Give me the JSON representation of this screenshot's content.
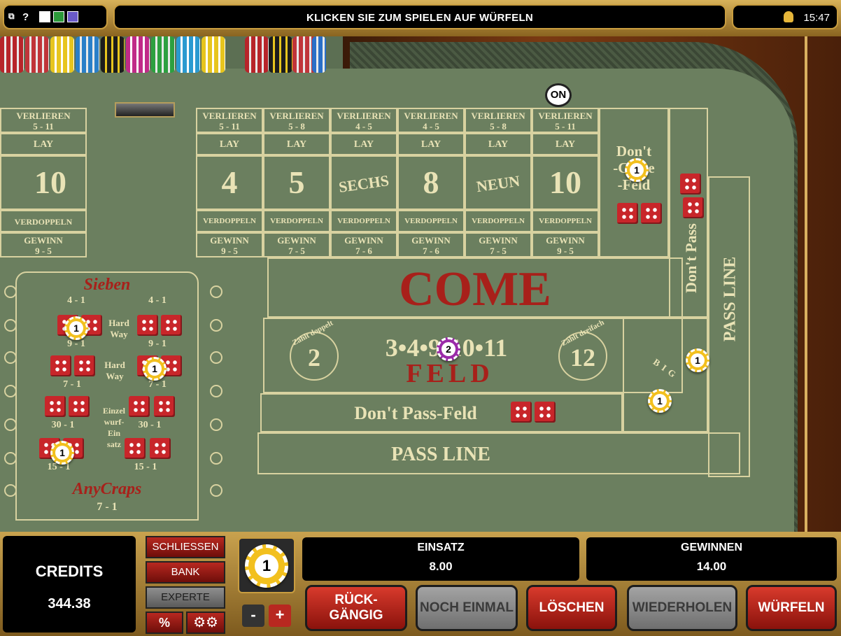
{
  "topbar": {
    "title": "KLICKEN SIE ZUM SPIELEN AUF WÜRFELN",
    "time": "15:47",
    "icons": [
      "window-icon",
      "help-icon",
      "checklist-icon",
      "dollar-icon",
      "stats-icon",
      "sound-icon"
    ]
  },
  "table": {
    "on_marker": "ON",
    "numbers": [
      {
        "top": "VERLIEREN",
        "top_odds": "5 - 11",
        "lay": "LAY",
        "number": "4",
        "double": "VERDOPPELN",
        "win": "GEWINN",
        "win_odds": "9 - 5"
      },
      {
        "top": "VERLIEREN",
        "top_odds": "5 - 8",
        "lay": "LAY",
        "number": "5",
        "double": "VERDOPPELN",
        "win": "GEWINN",
        "win_odds": "7 - 5"
      },
      {
        "top": "VERLIEREN",
        "top_odds": "4 - 5",
        "lay": "LAY",
        "number": "SECHS",
        "double": "VERDOPPELN",
        "win": "GEWINN",
        "win_odds": "7 - 6"
      },
      {
        "top": "VERLIEREN",
        "top_odds": "4 - 5",
        "lay": "LAY",
        "number": "8",
        "double": "VERDOPPELN",
        "win": "GEWINN",
        "win_odds": "7 - 6"
      },
      {
        "top": "VERLIEREN",
        "top_odds": "5 - 8",
        "lay": "LAY",
        "number": "NEUN",
        "double": "VERDOPPELN",
        "win": "GEWINN",
        "win_odds": "7 - 5"
      },
      {
        "top": "VERLIEREN",
        "top_odds": "5 - 11",
        "lay": "LAY",
        "number": "10",
        "double": "VERDOPPELN",
        "win": "GEWINN",
        "win_odds": "9 - 5"
      }
    ],
    "left_partial": {
      "top": "VERLIEREN",
      "top_odds": "5 - 11",
      "lay": "LAY",
      "number": "10",
      "double": "VERDOPPELN",
      "win": "GEWINN",
      "win_odds": "9 - 5"
    },
    "dont_come": "Don't Come -Feld",
    "dont_come_line1": "Don't",
    "dont_come_line2": "-Come",
    "dont_come_line3": "-Feld",
    "come": "COME",
    "field": {
      "label": "FELD",
      "double_note": "Zählt doppelt",
      "triple_note": "Zählt dreifach",
      "left_num": "2",
      "right_num": "12",
      "numbers": "3•4•9•10•11"
    },
    "dont_pass_field": "Don't Pass-Feld",
    "pass_line": "PASS LINE",
    "dont_pass": "Don't Pass",
    "pass_line_side": "PASS LINE",
    "big": "BIG",
    "props": {
      "sieben": "Sieben",
      "sieben_odds_l": "4 - 1",
      "sieben_odds_r": "4 - 1",
      "hard_way": "Hard Way",
      "hard_odds_1l": "9 - 1",
      "hard_odds_1r": "9 - 1",
      "hard_odds_2l": "7 - 1",
      "hard_odds_2r": "7 - 1",
      "einzel": "Einzel wurf- Ein satz",
      "einzel_l1": "Einzel",
      "einzel_l2": "wurf-",
      "einzel_l3": "Ein",
      "einzel_l4": "satz",
      "odds_30l": "30 - 1",
      "odds_30r": "30 - 1",
      "odds_15l": "15 - 1",
      "odds_15r": "15 - 1",
      "anycraps": "AnyCraps",
      "anycraps_odds": "7 - 1"
    },
    "chips": {
      "dont_come": "1",
      "hard1": "1",
      "hard2": "1",
      "craps": "1",
      "field": "2",
      "big1": "1",
      "big2": "1"
    }
  },
  "bottom": {
    "credits_label": "CREDITS",
    "credits_value": "344.38",
    "schliessen": "SCHLIESSEN",
    "bank": "BANK",
    "experte": "EXPERTE",
    "percent": "%",
    "chip_value": "1",
    "minus": "-",
    "plus": "+",
    "einsatz_label": "EINSATZ",
    "einsatz_value": "8.00",
    "gewinnen_label": "GEWINNEN",
    "gewinnen_value": "14.00",
    "buttons": {
      "undo": "RÜCK- GÄNGIG",
      "undo_l1": "RÜCK-",
      "undo_l2": "GÄNGIG",
      "again": "NOCH EINMAL",
      "clear": "LÖSCHEN",
      "repeat": "WIEDERHOLEN",
      "roll": "WÜRFELN"
    }
  },
  "colors": {
    "felt": "#6b7f5f",
    "gold": "#c99d3f",
    "red": "#a8201a",
    "text": "#e9e3b6"
  }
}
